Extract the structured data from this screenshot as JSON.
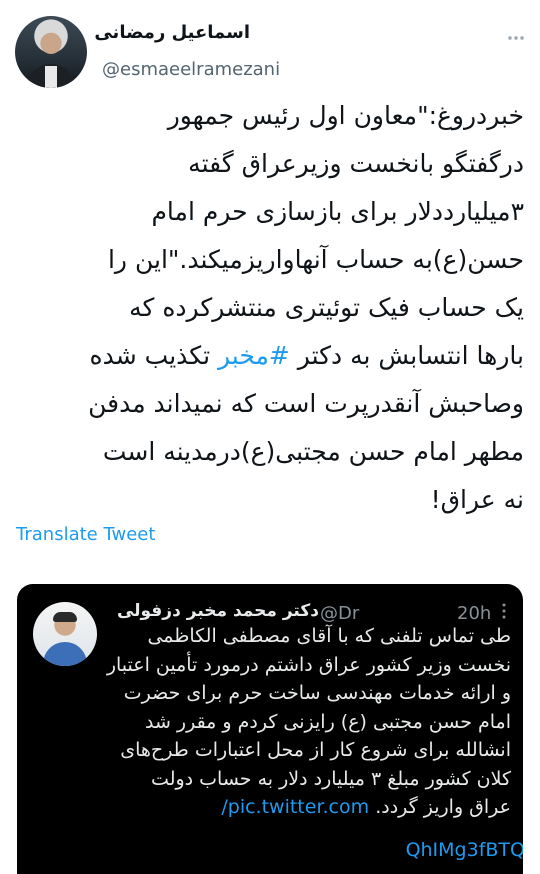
{
  "author": {
    "name": "اسماعیل رمضانی",
    "handle": "@esmaeelramezani"
  },
  "tweet": {
    "lines": [
      "خبردروغ:\"معاون اول رئیس جمهور",
      "درگفتگو بانخست وزیرعراق گفته",
      "۳میلیارددلار برای بازسازی حرم امام",
      "حسن(ع)به حساب آنهاواریزمیکند.\"این را",
      "یک حساب فیک توئیتری منتشرکرده که",
      "بارها انتسابش به دکتر ",
      "تکذیب شده",
      "وصاحبش آنقدرپرت است که نمیداند مدفن",
      "مطهر امام حسن مجتبی(ع)درمدینه است",
      "نه عراق!"
    ],
    "hashtag": "#مخبر"
  },
  "translate_label": "Translate Tweet",
  "quoted": {
    "name": "دکتر محمد مخبر دزفولی",
    "handle": "@Dr",
    "time": "20h",
    "lines": [
      "طی تماس تلفنی که با آقای مصطفی الکاظمی",
      "نخست وزیر کشور عراق داشتم درمورد تأمین اعتبار",
      "و ارائه خدمات مهندسی ساخت حرم برای حضرت",
      "امام حسن مجتبی (ع) رایزنی کردم و مقرر شد",
      "انشالله برای شروع کار از محل اعتبارات طرح‌های",
      "کلان کشور مبلغ ۳ میلیارد دلار به حساب دولت",
      "عراق واریز گردد."
    ],
    "link1": "pic.twitter.com/",
    "link2": "QhIMg3fBTQ"
  },
  "icons": {
    "more": "more-dots-icon"
  }
}
